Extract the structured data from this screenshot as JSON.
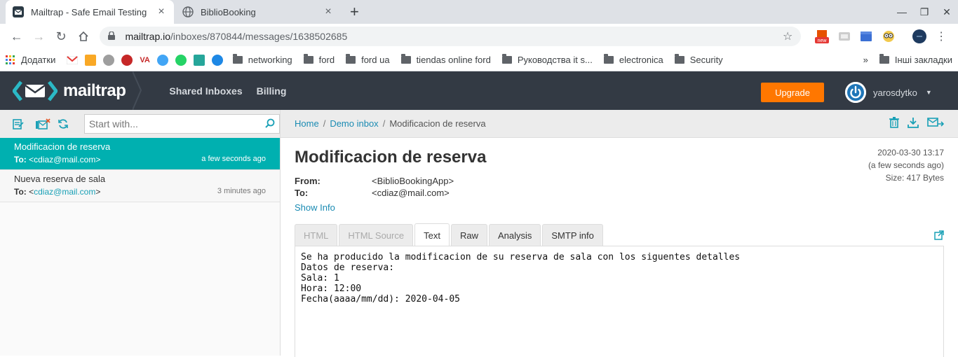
{
  "browser": {
    "tabs": [
      {
        "title": "Mailtrap - Safe Email Testing",
        "active": true
      },
      {
        "title": "BiblioBooking",
        "active": false
      }
    ],
    "url_domain": "mailtrap.io",
    "url_path": "/inboxes/870844/messages/1638502685",
    "bookmarks": {
      "apps_label": "Додатки",
      "folders": [
        "networking",
        "ford",
        "ford ua",
        "tiendas online ford",
        "Руководства it s...",
        "electronica",
        "Security"
      ],
      "other_label": "Інші закладки",
      "more": "»"
    },
    "ext_badge": "new"
  },
  "header": {
    "brand": "mailtrap",
    "nav": [
      "Shared Inboxes",
      "Billing"
    ],
    "upgrade_label": "Upgrade",
    "username": "yarosdytko",
    "colors": {
      "bar": "#333a44",
      "accent": "#00b0b0",
      "upgrade": "#ff7700"
    }
  },
  "sidebar": {
    "search_placeholder": "Start with...",
    "messages": [
      {
        "subject": "Modificacion de reserva",
        "to_label": "To:",
        "to_prefix": "<",
        "to": "cdiaz@mail.com",
        "to_suffix": ">",
        "time": "a few seconds ago",
        "active": true
      },
      {
        "subject": "Nueva reserva de sala",
        "to_label": "To:",
        "to_prefix": "<",
        "to": "cdiaz@mail.com",
        "to_suffix": ">",
        "time": "3 minutes ago",
        "active": false
      }
    ]
  },
  "breadcrumb": {
    "home": "Home",
    "inbox": "Demo inbox",
    "current": "Modificacion de reserva",
    "sep": "/"
  },
  "message": {
    "subject": "Modificacion de reserva",
    "from_label": "From:",
    "from": "<BiblioBookingApp>",
    "to_label": "To:",
    "to": "<cdiaz@mail.com>",
    "show_info": "Show Info",
    "date": "2020-03-30 13:17",
    "relative": "(a few seconds ago)",
    "size": "Size: 417 Bytes",
    "tabs": [
      {
        "label": "HTML",
        "state": "disabled"
      },
      {
        "label": "HTML Source",
        "state": "disabled"
      },
      {
        "label": "Text",
        "state": "active"
      },
      {
        "label": "Raw",
        "state": "normal"
      },
      {
        "label": "Analysis",
        "state": "normal"
      },
      {
        "label": "SMTP info",
        "state": "normal"
      }
    ],
    "body": "Se ha producido la modificacion de su reserva de sala con los siguentes detalles\nDatos de reserva:\nSala: 1\nHora: 12:00\nFecha(aaaa/mm/dd): 2020-04-05"
  }
}
